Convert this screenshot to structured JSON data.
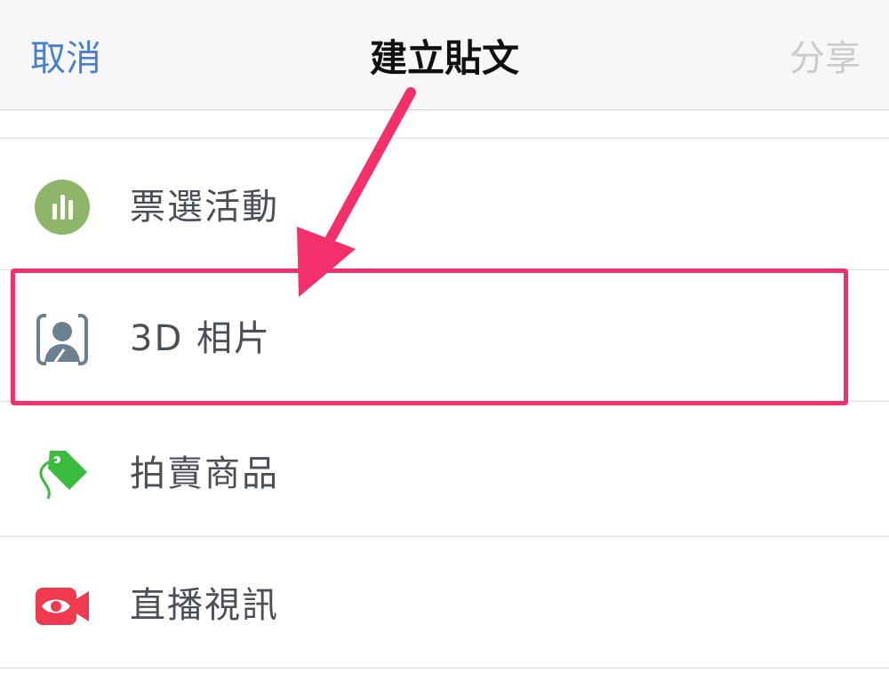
{
  "nav": {
    "cancel_label": "取消",
    "title": "建立貼文",
    "share_label": "分享"
  },
  "menu": {
    "items": [
      {
        "label": "票選活動",
        "icon": "poll-icon",
        "color": "#8fb56a"
      },
      {
        "label": "3D 相片",
        "icon": "3d-photo-icon",
        "color": "#6b8190"
      },
      {
        "label": "拍賣商品",
        "icon": "price-tag-icon",
        "color": "#3bbc3f"
      },
      {
        "label": "直播視訊",
        "icon": "live-video-icon",
        "color": "#f03a4f"
      }
    ]
  },
  "annotation": {
    "highlight_color": "#f4306c"
  }
}
